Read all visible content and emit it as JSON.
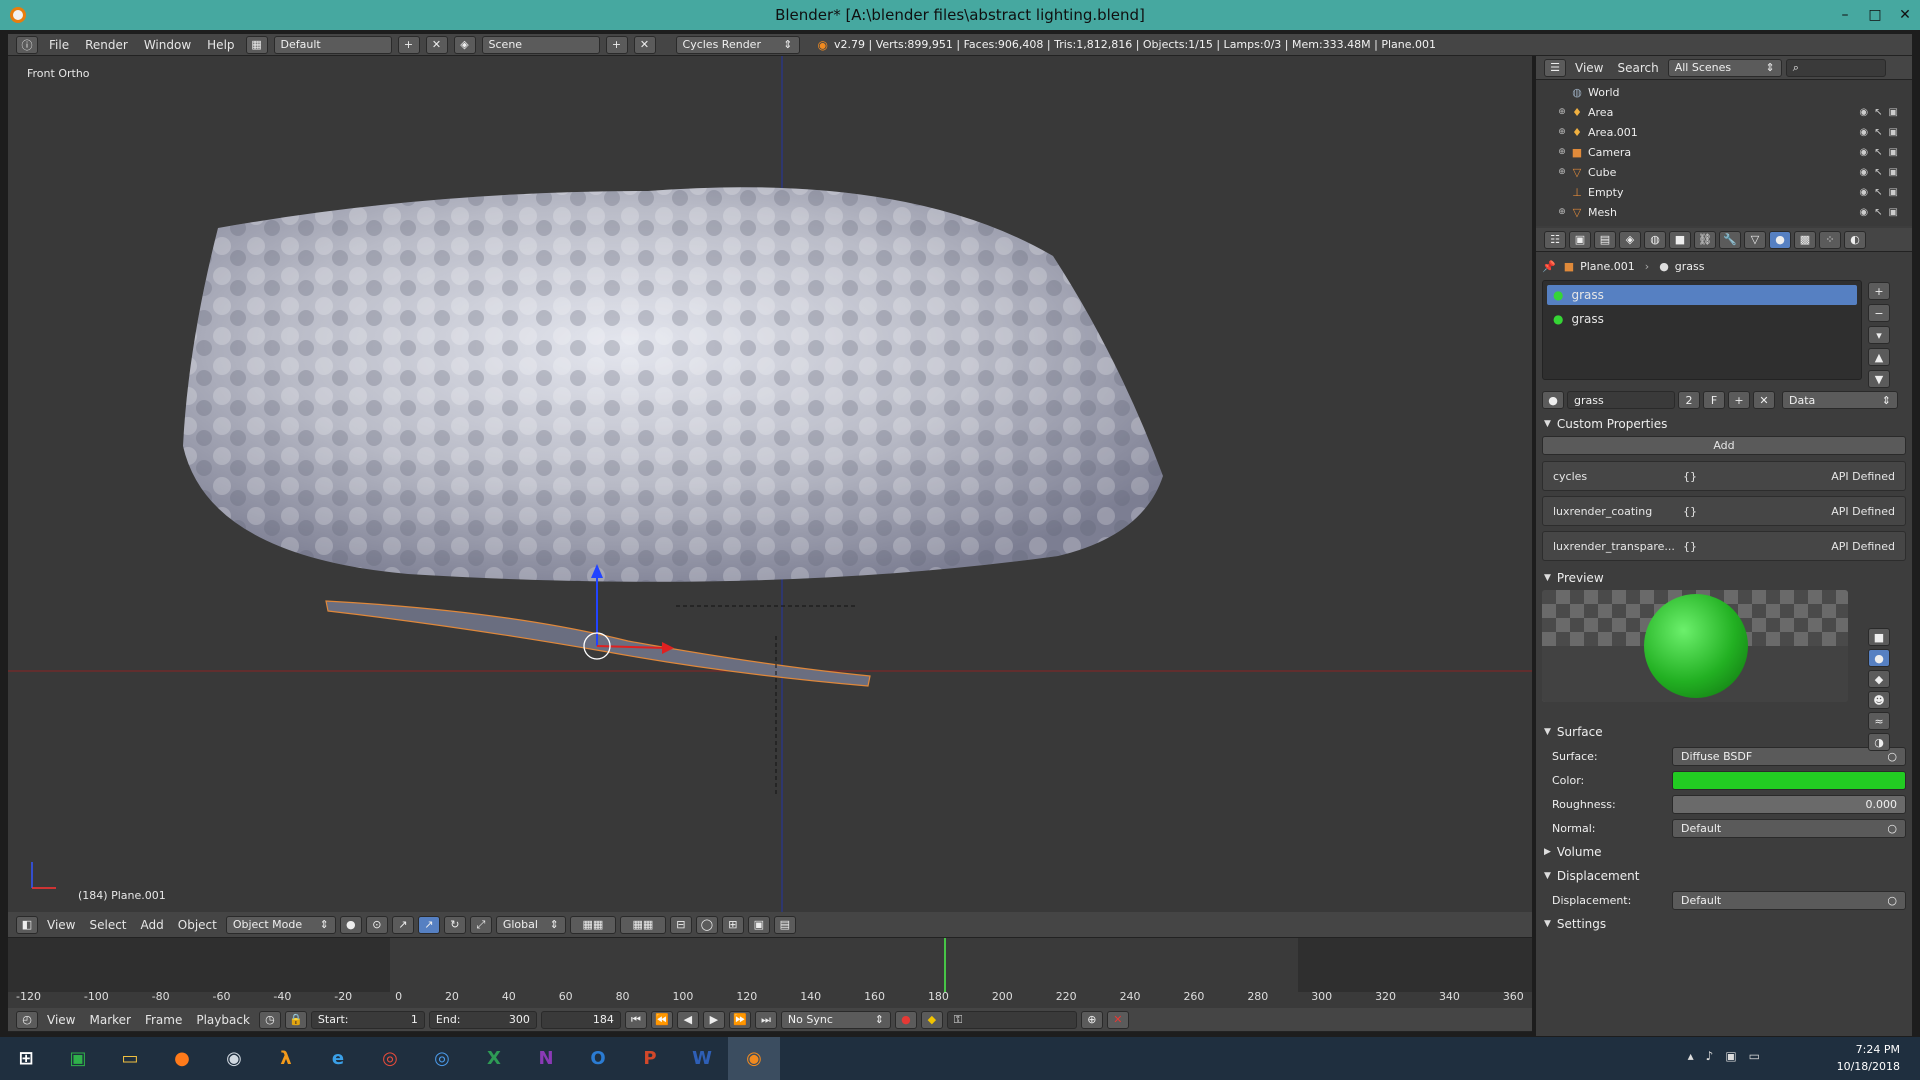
{
  "window": {
    "title": "Blender* [A:\\blender files\\abstract lighting.blend]",
    "min_glyph": "–",
    "max_glyph": "□",
    "close_glyph": "✕"
  },
  "info_header": {
    "menus": [
      "File",
      "Render",
      "Window",
      "Help"
    ],
    "layout": "Default",
    "scene": "Scene",
    "engine": "Cycles Render",
    "stats": "v2.79 | Verts:899,951 | Faces:906,408 | Tris:1,812,816 | Objects:1/15 | Lamps:0/3 | Mem:333.48M | Plane.001"
  },
  "viewport": {
    "view_name": "Front Ortho",
    "object_label": "(184) Plane.001"
  },
  "view3d_header": {
    "menus": [
      "View",
      "Select",
      "Add",
      "Object"
    ],
    "mode": "Object Mode",
    "orientation": "Global"
  },
  "timeline": {
    "ruler": [
      "-120",
      "-100",
      "-80",
      "-60",
      "-40",
      "-20",
      "0",
      "20",
      "40",
      "60",
      "80",
      "100",
      "120",
      "140",
      "160",
      "180",
      "200",
      "220",
      "240",
      "260",
      "280",
      "300",
      "320",
      "340",
      "360"
    ],
    "menus": [
      "View",
      "Marker",
      "Frame",
      "Playback"
    ],
    "start_label": "Start:",
    "start": "1",
    "end_label": "End:",
    "end": "300",
    "current": "184",
    "sync": "No Sync"
  },
  "outliner": {
    "menus": [
      "View",
      "Search"
    ],
    "scenes": "All Scenes",
    "items": [
      {
        "name": "World",
        "icon": "world-icon"
      },
      {
        "name": "Area",
        "icon": "lamp-icon"
      },
      {
        "name": "Area.001",
        "icon": "lamp-icon"
      },
      {
        "name": "Camera",
        "icon": "camera-icon"
      },
      {
        "name": "Cube",
        "icon": "mesh-icon"
      },
      {
        "name": "Empty",
        "icon": "empty-icon"
      },
      {
        "name": "Mesh",
        "icon": "mesh-icon"
      }
    ]
  },
  "properties": {
    "breadcrumb": [
      "Plane.001",
      "grass"
    ],
    "material_slots": [
      "grass",
      "grass"
    ],
    "material_name": "grass",
    "users": "2",
    "fake_user": "F",
    "link": "Data",
    "custom_props": {
      "title": "Custom Properties",
      "add": "Add",
      "rows": [
        {
          "name": "cycles",
          "braces": "{}",
          "status": "API Defined"
        },
        {
          "name": "luxrender_coating",
          "braces": "{}",
          "status": "API Defined"
        },
        {
          "name": "luxrender_transpare...",
          "braces": "{}",
          "status": "API Defined"
        }
      ]
    },
    "preview_title": "Preview",
    "surface_title": "Surface",
    "surface_label": "Surface:",
    "surface": "Diffuse BSDF",
    "color_label": "Color:",
    "color": "#22cc22",
    "roughness_label": "Roughness:",
    "roughness": "0.000",
    "normal_label": "Normal:",
    "normal": "Default",
    "volume_title": "Volume",
    "displacement_title": "Displacement",
    "displacement_label": "Displacement:",
    "displacement": "Default",
    "settings_title": "Settings"
  },
  "taskbar": {
    "time": "7:24 PM",
    "date": "10/18/2018",
    "apps": [
      {
        "name": "store-icon",
        "glyph": "▣",
        "color": "#2fb14a"
      },
      {
        "name": "file-explorer-icon",
        "glyph": "▭",
        "color": "#f0c040"
      },
      {
        "name": "firefox-icon",
        "glyph": "●",
        "color": "#ff7a1a"
      },
      {
        "name": "steam-icon",
        "glyph": "◉",
        "color": "#d0d8e0"
      },
      {
        "name": "half-life-icon",
        "glyph": "λ",
        "color": "#f29a1b"
      },
      {
        "name": "edge-icon",
        "glyph": "e",
        "color": "#3aa0e8"
      },
      {
        "name": "chrome-icon",
        "glyph": "◎",
        "color": "#e84b3a"
      },
      {
        "name": "chrome-alt-icon",
        "glyph": "◎",
        "color": "#4b9ae8"
      },
      {
        "name": "excel-icon",
        "glyph": "X",
        "color": "#2e9b55"
      },
      {
        "name": "onenote-icon",
        "glyph": "N",
        "color": "#8a3ab5"
      },
      {
        "name": "outlook-icon",
        "glyph": "O",
        "color": "#2b7cd3"
      },
      {
        "name": "powerpoint-icon",
        "glyph": "P",
        "color": "#d2482a"
      },
      {
        "name": "word-icon",
        "glyph": "W",
        "color": "#2e5fb6"
      },
      {
        "name": "blender-icon",
        "glyph": "◉",
        "color": "#f08a20"
      }
    ]
  }
}
